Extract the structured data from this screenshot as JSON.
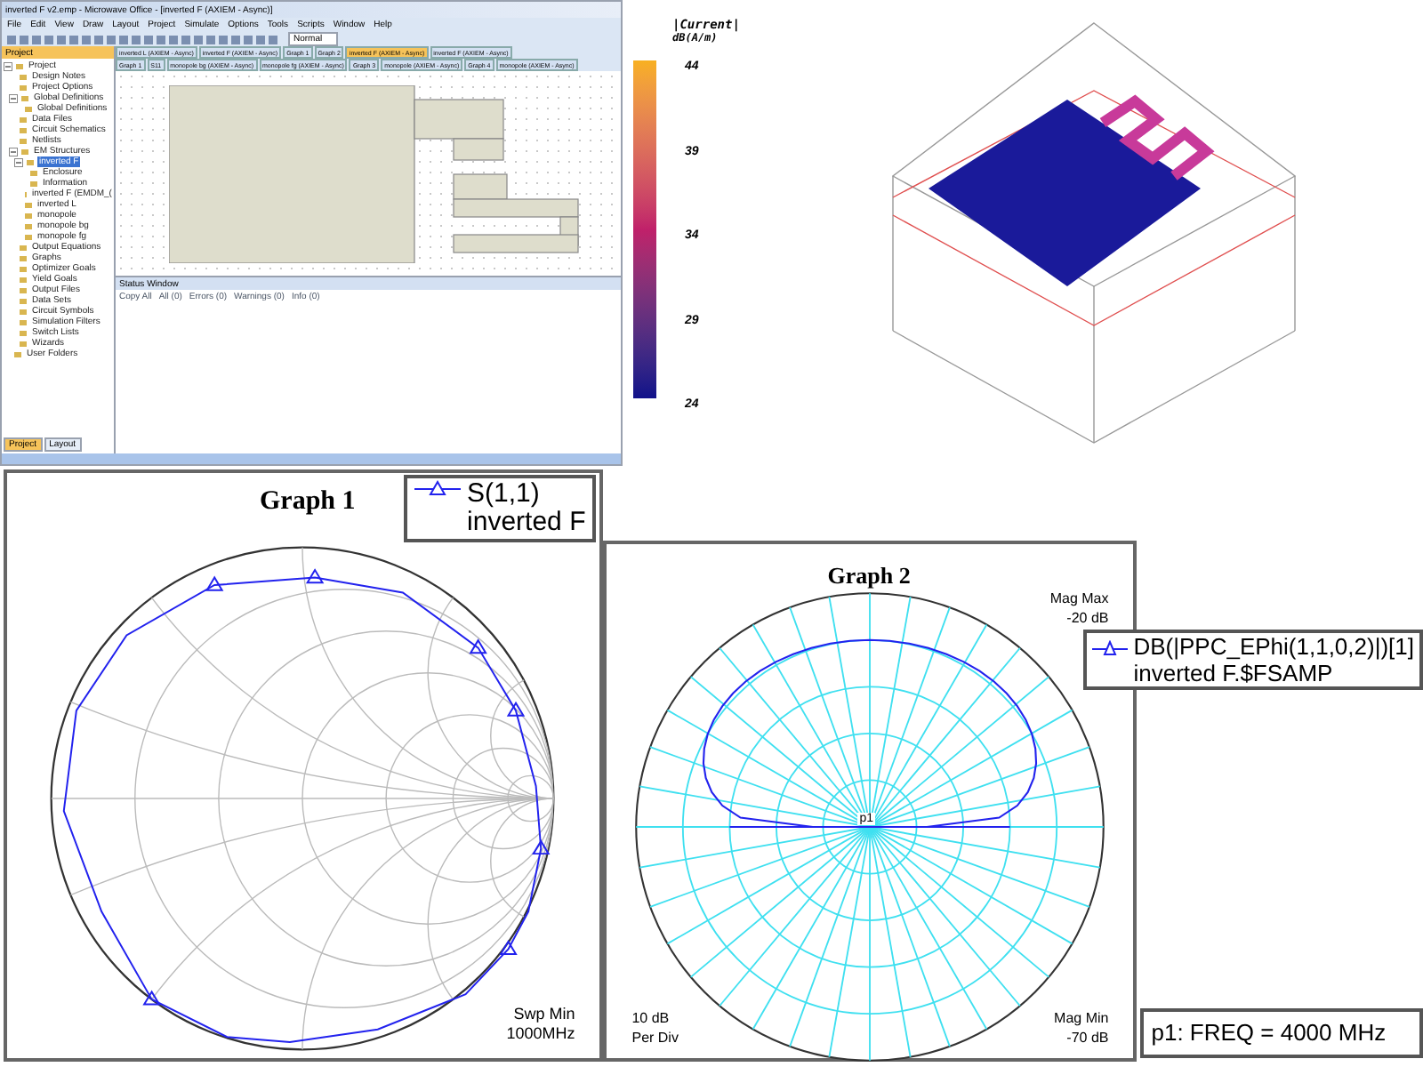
{
  "app_window": {
    "title": "inverted F v2.emp - Microwave Office - [inverted F (AXIEM - Async)]",
    "menu": [
      "File",
      "Edit",
      "View",
      "Draw",
      "Layout",
      "Project",
      "Simulate",
      "Options",
      "Tools",
      "Scripts",
      "Window",
      "Help"
    ],
    "toolbar_combo": "Normal",
    "panel_title": "Project",
    "tree": [
      {
        "label": "Project",
        "expanded": true,
        "selected": false,
        "children": [
          {
            "label": "Design Notes",
            "selected": false
          },
          {
            "label": "Project Options",
            "selected": false
          },
          {
            "label": "Global Definitions",
            "expanded": true,
            "selected": false,
            "children": [
              {
                "label": "Global Definitions",
                "selected": false
              }
            ]
          },
          {
            "label": "Data Files",
            "selected": false
          },
          {
            "label": "Circuit Schematics",
            "selected": false
          },
          {
            "label": "Netlists",
            "selected": false
          },
          {
            "label": "EM Structures",
            "expanded": true,
            "selected": false,
            "children": [
              {
                "label": "inverted F",
                "expanded": true,
                "selected": true,
                "children": [
                  {
                    "label": "Enclosure",
                    "selected": false
                  },
                  {
                    "label": "Information",
                    "selected": false
                  },
                  {
                    "label": "inverted F (EMDM_(",
                    "selected": false
                  }
                ]
              },
              {
                "label": "inverted L",
                "selected": false
              },
              {
                "label": "monopole",
                "selected": false
              },
              {
                "label": "monopole bg",
                "selected": false
              },
              {
                "label": "monopole fg",
                "selected": false
              }
            ]
          },
          {
            "label": "Output Equations",
            "selected": false
          },
          {
            "label": "Graphs",
            "selected": false
          },
          {
            "label": "Optimizer Goals",
            "selected": false
          },
          {
            "label": "Yield Goals",
            "selected": false
          },
          {
            "label": "Output Files",
            "selected": false
          },
          {
            "label": "Data Sets",
            "selected": false
          },
          {
            "label": "Circuit Symbols",
            "selected": false
          },
          {
            "label": "Simulation Filters",
            "selected": false
          },
          {
            "label": "Switch Lists",
            "selected": false
          },
          {
            "label": "Wizards",
            "selected": false
          }
        ]
      },
      {
        "label": "User Folders",
        "selected": false
      }
    ],
    "doc_tabs": [
      [
        {
          "label": "inverted L (AXIEM - Async)",
          "selected": false
        },
        {
          "label": "inverted F (AXIEM - Async)",
          "selected": false
        },
        {
          "label": "Graph 1",
          "selected": false
        },
        {
          "label": "Graph 2",
          "selected": false
        },
        {
          "label": "inverted F (AXIEM - Async)",
          "selected": true
        },
        {
          "label": "inverted F (AXIEM - Async)",
          "selected": false
        }
      ],
      [
        {
          "label": "Graph 1",
          "selected": false
        },
        {
          "label": "S11",
          "selected": false
        },
        {
          "label": "monopole bg (AXIEM - Async)",
          "selected": false
        },
        {
          "label": "monopole fg (AXIEM - Async)",
          "selected": false
        },
        {
          "label": "Graph 3",
          "selected": false
        },
        {
          "label": "monopole (AXIEM - Async)",
          "selected": false
        },
        {
          "label": "Graph 4",
          "selected": false
        },
        {
          "label": "monopole (AXIEM - Async)",
          "selected": false
        }
      ]
    ],
    "status_window": {
      "title": "Status Window",
      "buttons": [
        "Copy All",
        "All (0)",
        "Errors (0)",
        "Warnings (0)",
        "Info (0)"
      ]
    },
    "bottom_tabs": [
      {
        "label": "Project",
        "selected": true
      },
      {
        "label": "Layout",
        "selected": false
      }
    ]
  },
  "color_legend": {
    "title": "|Current|",
    "unit": "dB(A/m)",
    "ticks": [
      "44",
      "39",
      "34",
      "29",
      "24"
    ]
  },
  "graph_1": {
    "title": "Graph 1",
    "legend": {
      "trace": "S(1,1)",
      "source": "inverted F"
    },
    "sweep_label": "Swp Min",
    "sweep_value": "1000MHz"
  },
  "graph_2": {
    "title": "Graph 2",
    "mag_max_label": "Mag Max",
    "mag_max": "-20 dB",
    "div_value": "10 dB",
    "div_label": "Per Div",
    "mag_min_label": "Mag Min",
    "mag_min": "-70 dB",
    "marker": "p1",
    "legend": {
      "trace": "DB(|PPC_EPhi(1,1,0,2)|)[1]",
      "source": "inverted F.$FSAMP"
    },
    "marker_readout": "p1: FREQ = 4000 MHz"
  }
}
